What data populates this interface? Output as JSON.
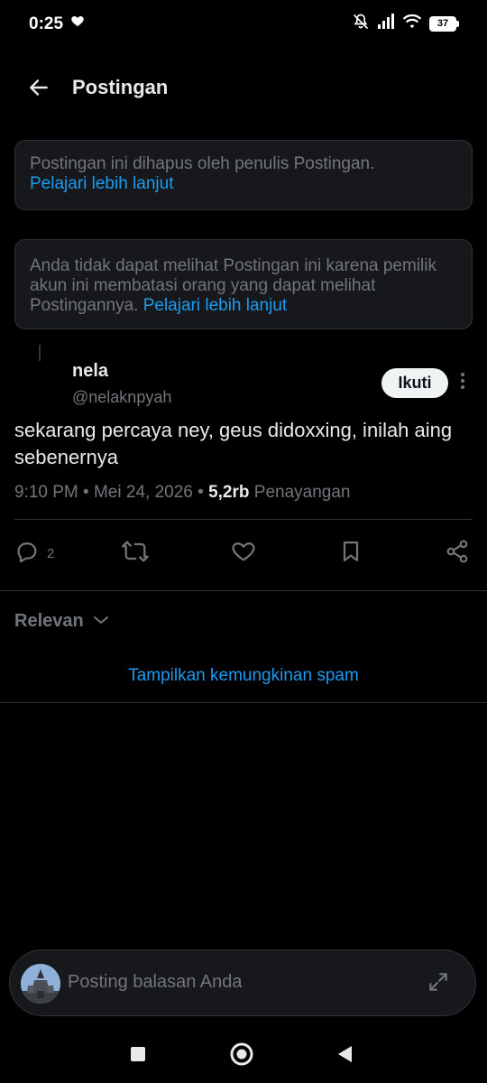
{
  "status_bar": {
    "time": "0:25",
    "battery": "37",
    "icons": [
      "heart-icon",
      "mute-icon",
      "signal-icon",
      "wifi-icon",
      "battery-icon"
    ]
  },
  "header": {
    "title": "Postingan",
    "back_icon": "arrow-left-icon"
  },
  "notices": [
    {
      "text": "Postingan ini dihapus oleh penulis Postingan.",
      "link": "Pelajari lebih lanjut"
    },
    {
      "text": "Anda tidak dapat melihat Postingan ini karena pemilik akun ini membatasi orang yang dapat melihat Postingannya.",
      "link": "Pelajari lebih lanjut"
    }
  ],
  "post": {
    "author_name": "nela",
    "author_handle": "@nelaknpyah",
    "follow_label": "Ikuti",
    "text": "sekarang percaya ney, geus didoxxing, inilah aing sebenernya",
    "time": "9:10 PM",
    "date": "Mei 24, 2026",
    "views_count": "5,2rb",
    "views_label": "Penayangan",
    "separator": "•",
    "actions": {
      "reply_count": "2"
    }
  },
  "sort": {
    "label": "Relevan"
  },
  "spam_link": "Tampilkan kemungkinan spam",
  "reply_bar": {
    "placeholder": "Posting balasan Anda"
  },
  "colors": {
    "background": "#000000",
    "card": "#16181c",
    "border": "#2f3336",
    "text": "#e7e9ea",
    "muted": "#71767b",
    "link": "#1d9bf0"
  }
}
